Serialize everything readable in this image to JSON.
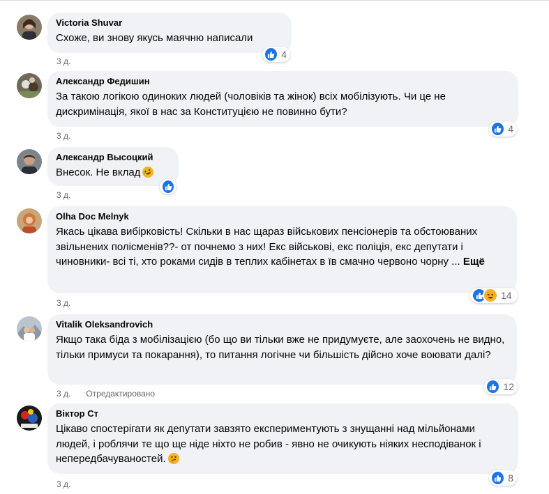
{
  "comments": [
    {
      "author": "Victoria Shuvar",
      "text": "Схоже, ви знову якусь маячню написали",
      "time": "3 д.",
      "reactions": "4",
      "reaction_types": [
        "like"
      ],
      "emoji": ""
    },
    {
      "author": "Александр Федишин",
      "text": "За такою логікою одиноких людей (чоловіків та жінок) всіх мобілізують. Чи це не дискримінація, якої в нас за Конституцією не повинно бути?",
      "time": "3 д.",
      "reactions": "4",
      "reaction_types": [
        "like"
      ],
      "emoji": ""
    },
    {
      "author": "Александр Высоцкий",
      "text": "Внесок. Не вклад",
      "time": "3 д.",
      "reactions": "",
      "reaction_types": [
        "like"
      ],
      "emoji": "rofl-emoji"
    },
    {
      "author": "Olha Doc Melnyk",
      "text": "Якась цікава вибірковість! Скільки в нас щараз військових пенсіонерів та обстоюваних звільнених полісменів??- от почнемо з них! Екс військові, екс поліція, екс депутати і чиновники- всі ті, хто роками сидів в теплих кабінетах в їв смачно червоно чорну ...",
      "more": "Ещё",
      "time": "3 д.",
      "reactions": "14",
      "reaction_types": [
        "like",
        "haha"
      ],
      "emoji": ""
    },
    {
      "author": "Vitalik Oleksandrovich",
      "text": "Якщо така біда з мобілізацією (бо що ви тільки вже не придумуєте, але заохочень не видно, тільки примуси та покарання), то питання логічне чи більшість дійсно хоче воювати далі?",
      "time": "3 д.",
      "edited": "Отредактировано",
      "reactions": "12",
      "reaction_types": [
        "like"
      ],
      "emoji": ""
    },
    {
      "author": "Віктор Ст",
      "text": "Цікаво спостерігати як депутати завзято експериментують з знущанні над мільйонами людей, і роблячи те що ще ніде ніхто не робив - явно не очикують ніяких несподіванок і непередбачуваностей.",
      "time": "3 д.",
      "reactions": "8",
      "reaction_types": [
        "like"
      ],
      "emoji": "thinking-emoji"
    }
  ],
  "colors": {
    "bubble": "#f0f2f5",
    "like": "#1b74e4",
    "haha": "#f7b125",
    "meta": "#65676b"
  }
}
